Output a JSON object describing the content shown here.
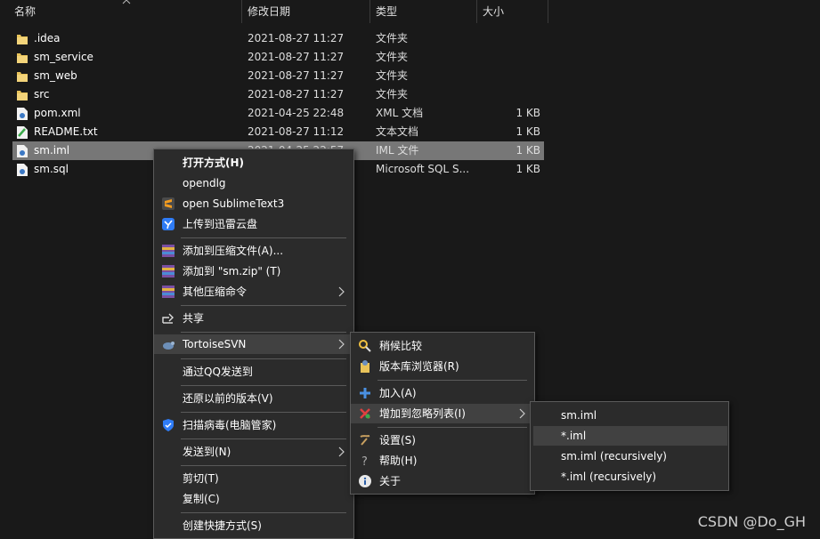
{
  "columns": {
    "name": "名称",
    "date": "修改日期",
    "type": "类型",
    "size": "大小"
  },
  "files": [
    {
      "name": ".idea",
      "date": "2021-08-27 11:27",
      "type": "文件夹",
      "size": "",
      "icon": "folder-icon"
    },
    {
      "name": "sm_service",
      "date": "2021-08-27 11:27",
      "type": "文件夹",
      "size": "",
      "icon": "folder-icon"
    },
    {
      "name": "sm_web",
      "date": "2021-08-27 11:27",
      "type": "文件夹",
      "size": "",
      "icon": "folder-icon"
    },
    {
      "name": "src",
      "date": "2021-08-27 11:27",
      "type": "文件夹",
      "size": "",
      "icon": "folder-icon"
    },
    {
      "name": "pom.xml",
      "date": "2021-04-25 22:48",
      "type": "XML 文档",
      "size": "1 KB",
      "icon": "xml-file-icon"
    },
    {
      "name": "README.txt",
      "date": "2021-08-27 11:12",
      "type": "文本文档",
      "size": "1 KB",
      "icon": "text-file-icon"
    },
    {
      "name": "sm.iml",
      "date": "2021-04-25 22:57",
      "type": "IML 文件",
      "size": "1 KB",
      "icon": "file-icon"
    },
    {
      "name": "sm.sql",
      "date": "",
      "type": "Microsoft SQL S...",
      "size": "1 KB",
      "icon": "file-icon"
    }
  ],
  "context_menu": {
    "open_with": "打开方式(H)",
    "opendlg": "opendlg",
    "open_sublime": "open SublimeText3",
    "upload_xunlei": "上传到迅雷云盘",
    "add_archive": "添加到压缩文件(A)...",
    "add_zip": "添加到 \"sm.zip\" (T)",
    "other_compress": "其他压缩命令",
    "share": "共享",
    "tortoise": "TortoiseSVN",
    "send_qq": "通过QQ发送到",
    "restore": "还原以前的版本(V)",
    "scan": "扫描病毒(电脑管家)",
    "send_to": "发送到(N)",
    "cut": "剪切(T)",
    "copy": "复制(C)",
    "create_shortcut": "创建快捷方式(S)"
  },
  "svn_menu": {
    "diff": "稍候比较",
    "repo_browser": "版本库浏览器(R)",
    "add": "加入(A)",
    "add_ignore": "增加到忽略列表(I)",
    "settings": "设置(S)",
    "help": "帮助(H)",
    "about": "关于"
  },
  "ignore_menu": {
    "opt1": "sm.iml",
    "opt2": "*.iml",
    "opt3": "sm.iml (recursively)",
    "opt4": "*.iml (recursively)"
  },
  "watermark": "CSDN @Do_GH",
  "colors": {
    "background": "#191919",
    "menu_bg": "#2b2b2b",
    "highlight": "#414141",
    "selected_row": "#777777"
  }
}
